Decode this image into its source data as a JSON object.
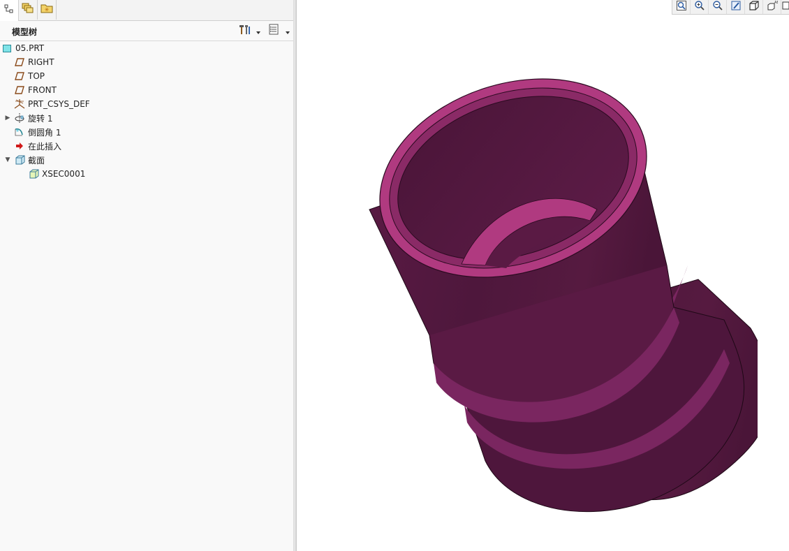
{
  "left_panel": {
    "tabs": [
      {
        "icon": "model-tree-tab-icon"
      },
      {
        "icon": "layers-tab-icon"
      },
      {
        "icon": "favorites-folder-tab-icon"
      }
    ],
    "header": {
      "title": "模型树",
      "settings_icon": "tree-settings-icon",
      "show_icon": "tree-show-icon"
    },
    "tree": [
      {
        "label": "05.PRT",
        "icon": "part-icon"
      },
      {
        "label": "RIGHT",
        "icon": "datum-plane-icon"
      },
      {
        "label": "TOP",
        "icon": "datum-plane-icon"
      },
      {
        "label": "FRONT",
        "icon": "datum-plane-icon"
      },
      {
        "label": "PRT_CSYS_DEF",
        "icon": "coordinate-system-icon"
      },
      {
        "label": "旋转 1",
        "icon": "revolve-icon",
        "expandable": true
      },
      {
        "label": "倒圆角 1",
        "icon": "round-icon"
      },
      {
        "label": "在此插入",
        "icon": "insert-here-arrow-icon"
      },
      {
        "label": "截面",
        "icon": "sections-folder-icon",
        "expanded": true
      },
      {
        "label": "XSEC0001",
        "icon": "section-icon"
      }
    ]
  },
  "graphics": {
    "toolbar": [
      "refit-icon",
      "zoom-in-icon",
      "zoom-out-icon",
      "repaint-icon",
      "display-style-icon",
      "saved-orientations-icon",
      "view-manager-icon"
    ],
    "model_color": "#8a2a66",
    "model_highlight": "#b03a80"
  }
}
